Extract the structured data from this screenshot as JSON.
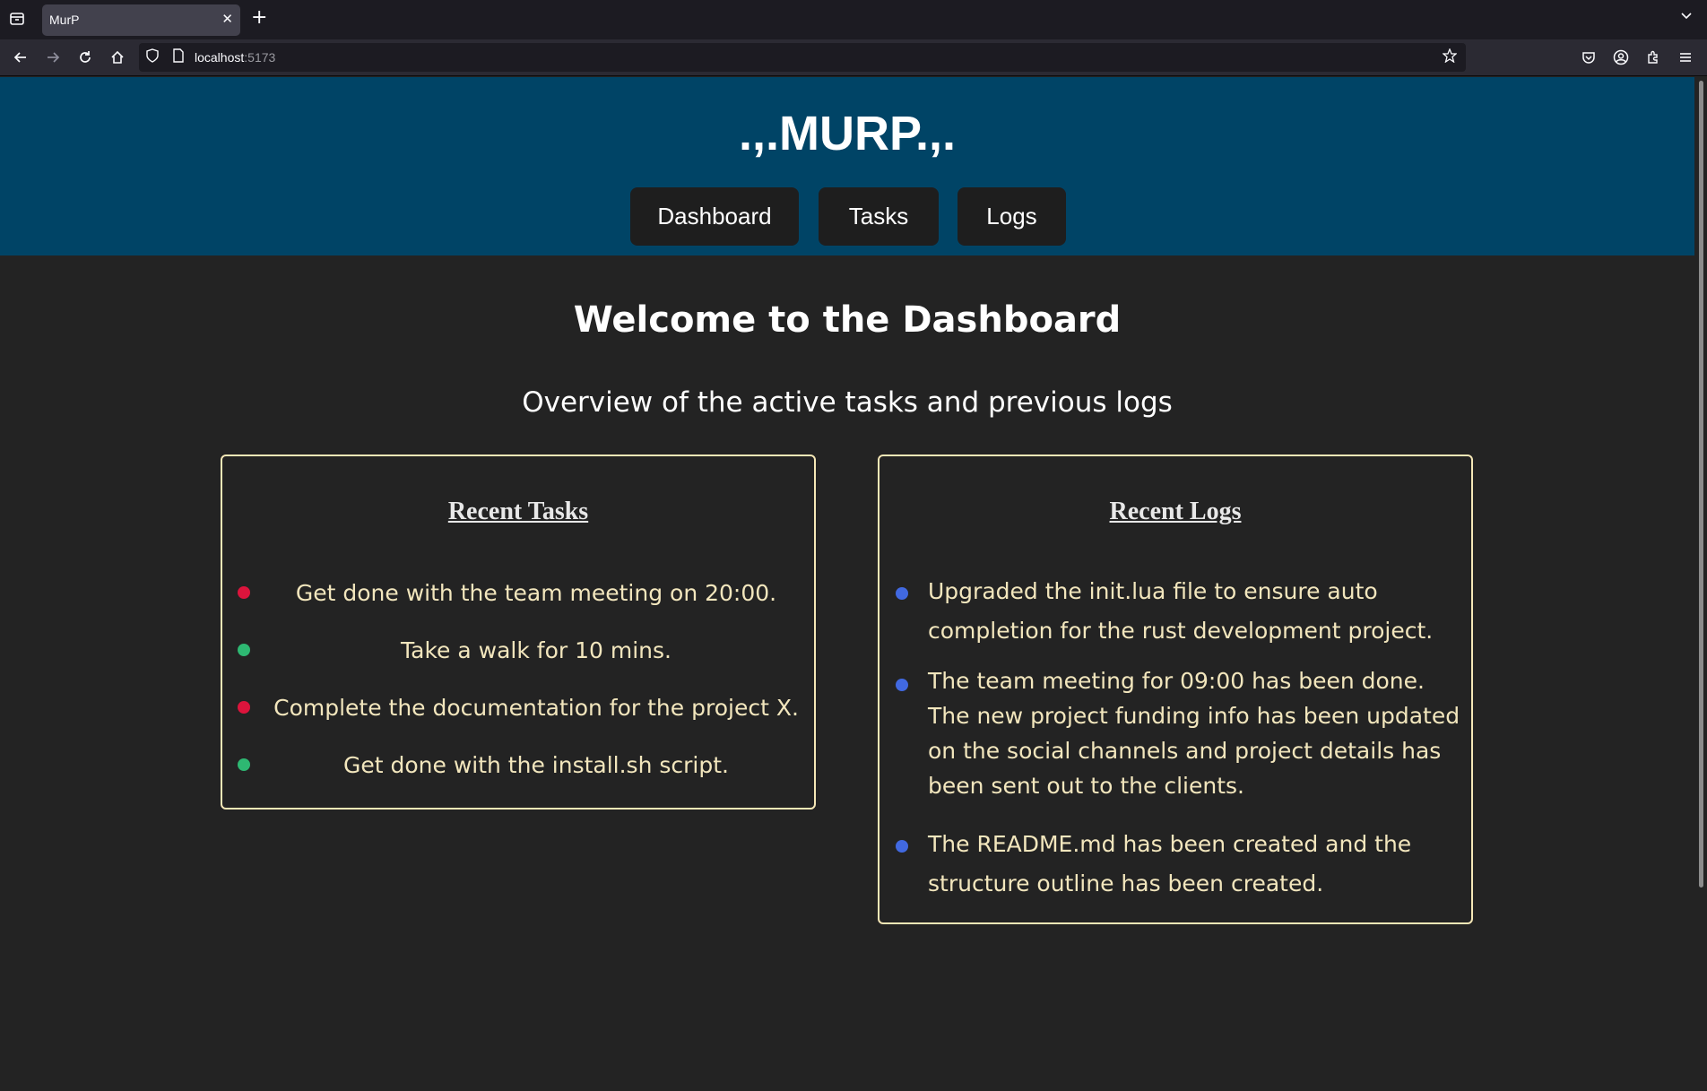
{
  "browser": {
    "tab_title": "MurP",
    "url_host": "localhost",
    "url_port": ":5173"
  },
  "header": {
    "title": ".,.MURP.,.",
    "nav": [
      {
        "label": "Dashboard"
      },
      {
        "label": "Tasks"
      },
      {
        "label": "Logs"
      }
    ]
  },
  "main": {
    "title": "Welcome to the Dashboard",
    "subtitle": "Overview of the active tasks and previous logs"
  },
  "tasks_card": {
    "title": "Recent Tasks",
    "items": [
      {
        "text": "Get done with the team meeting on 20:00.",
        "status_color": "#dc143c"
      },
      {
        "text": "Take a walk for 10 mins.",
        "status_color": "#2eb872"
      },
      {
        "text": "Complete the documentation for the project X.",
        "status_color": "#dc143c"
      },
      {
        "text": "Get done with the install.sh script.",
        "status_color": "#2eb872"
      }
    ]
  },
  "logs_card": {
    "title": "Recent Logs",
    "items": [
      {
        "text": "Upgraded the init.lua file to ensure auto completion for the rust development project."
      },
      {
        "text": "The team meeting for 09:00 has been done. The new project funding info has been updated on the social channels and project details has been sent out to the clients."
      },
      {
        "text": "The README.md has been created and the structure outline has been created."
      }
    ],
    "bullet_color": "#4169e1"
  },
  "colors": {
    "header_bg": "#004466",
    "page_bg": "#232323",
    "card_border": "#f5e7b6",
    "item_text": "#f2e6bd"
  }
}
